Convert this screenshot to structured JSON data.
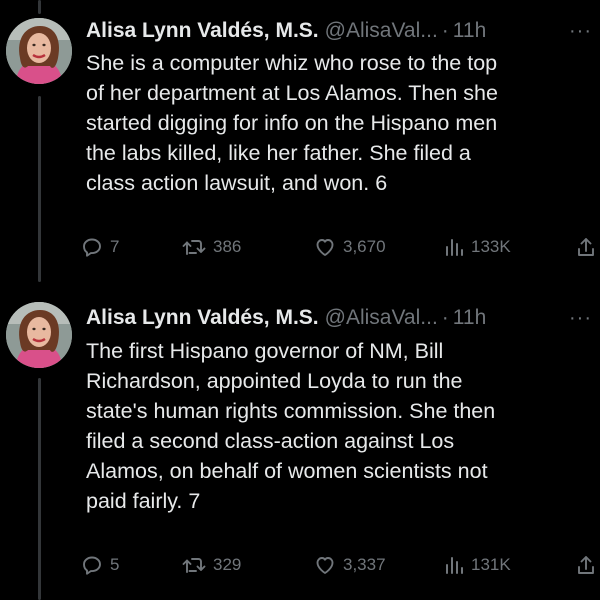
{
  "tweets": [
    {
      "author": {
        "display_name": "Alisa Lynn Valdés, M.S.",
        "handle": "@AlisaVal...",
        "avatar_icon": "profile-photo"
      },
      "separator": "·",
      "time": "11h",
      "more_label": "···",
      "lines": [
        "She is a computer whiz who rose to the top",
        "of her department at Los Alamos. Then she",
        "started digging for info on the Hispano men",
        "the labs killed, like her father. She filed a",
        "class action lawsuit, and won. 6"
      ],
      "stats": {
        "replies": "7",
        "retweets": "386",
        "likes": "3,670",
        "views": "133K"
      }
    },
    {
      "author": {
        "display_name": "Alisa Lynn Valdés, M.S.",
        "handle": "@AlisaVal...",
        "avatar_icon": "profile-photo"
      },
      "separator": "·",
      "time": "11h",
      "more_label": "···",
      "lines": [
        "The first Hispano governor of NM, Bill",
        "Richardson, appointed Loyda to run the",
        "state's human rights commission. She then",
        "filed a second class-action against Los",
        "Alamos, on behalf of women scientists not",
        "paid fairly. 7"
      ],
      "stats": {
        "replies": "5",
        "retweets": "329",
        "likes": "3,337",
        "views": "131K"
      }
    }
  ],
  "colors": {
    "background": "#000000",
    "text": "#e7e9ea",
    "muted": "#71767b",
    "thread_line": "#333639"
  }
}
